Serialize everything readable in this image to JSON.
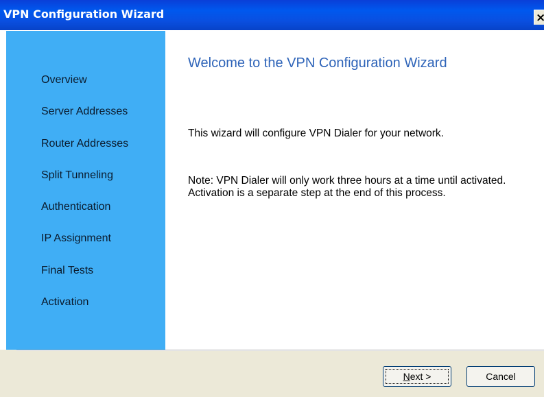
{
  "window": {
    "title": "VPN Configuration Wizard",
    "close_glyph": "×",
    "close_icon": "close-icon"
  },
  "sidebar": {
    "items": [
      {
        "label": "Overview"
      },
      {
        "label": "Server Addresses"
      },
      {
        "label": "Router Addresses"
      },
      {
        "label": "Split Tunneling"
      },
      {
        "label": "Authentication"
      },
      {
        "label": "IP Assignment"
      },
      {
        "label": "Final Tests"
      },
      {
        "label": "Activation"
      }
    ]
  },
  "main": {
    "heading": "Welcome to the VPN Configuration Wizard",
    "intro": "This wizard will configure VPN Dialer for your network.",
    "note": "Note: VPN Dialer will only work three hours at a time until activated. Activation is a separate step at the end of this process."
  },
  "footer": {
    "next_label_mnemonic": "N",
    "next_label_rest": "ext >",
    "cancel_label": "Cancel"
  },
  "colors": {
    "titlebar": "#0058ee",
    "sidebar": "#40aef5",
    "heading": "#2d63b8",
    "dialog_face": "#ece9d8"
  }
}
